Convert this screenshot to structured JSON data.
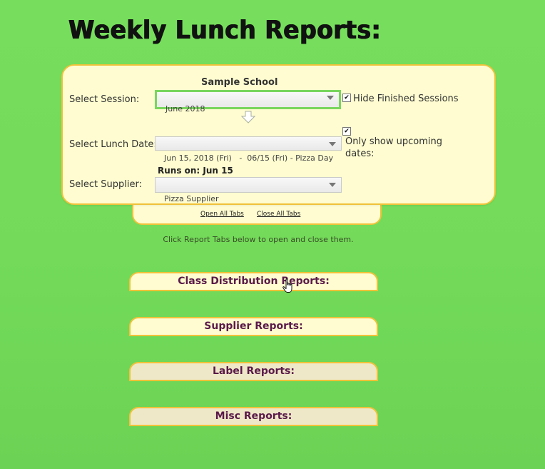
{
  "page": {
    "title": "Weekly Lunch Reports:"
  },
  "settings_panel": {
    "school_name": "Sample School",
    "session": {
      "label": "Select Session:",
      "selected": "June 2018",
      "hide_finished_label": "Hide Finished Sessions",
      "hide_finished_checked": true
    },
    "lunch_date": {
      "label": "Select Lunch Date:",
      "selected": "Jun 15, 2018 (Fri)   -  06/15 (Fri) - Pizza Day",
      "upcoming_label_line1": "Only show upcoming",
      "upcoming_label_line2": "dates:",
      "upcoming_checked": true
    },
    "supplier": {
      "runs_on": "Runs on: Jun 15",
      "label": "Select Supplier:",
      "selected": "Pizza Supplier"
    }
  },
  "tab_controls": {
    "open_all": "Open All Tabs",
    "close_all": "Close All Tabs"
  },
  "hint": "Click Report Tabs below to open and close them.",
  "report_tabs": [
    {
      "label": "Class Distribution Reports:"
    },
    {
      "label": "Supplier Reports:"
    },
    {
      "label": "Label Reports:"
    },
    {
      "label": "Misc Reports:"
    }
  ],
  "colors": {
    "background": "#76de5c",
    "panel": "#fefcd0",
    "border": "#f0c23a",
    "tab_text": "#5a1a4a",
    "focus": "#79d65d"
  },
  "icons": {
    "down_arrow": "outline-down-arrow-icon",
    "cursor": "hand-pointer-icon",
    "dropdown": "dropdown-arrow-icon"
  }
}
